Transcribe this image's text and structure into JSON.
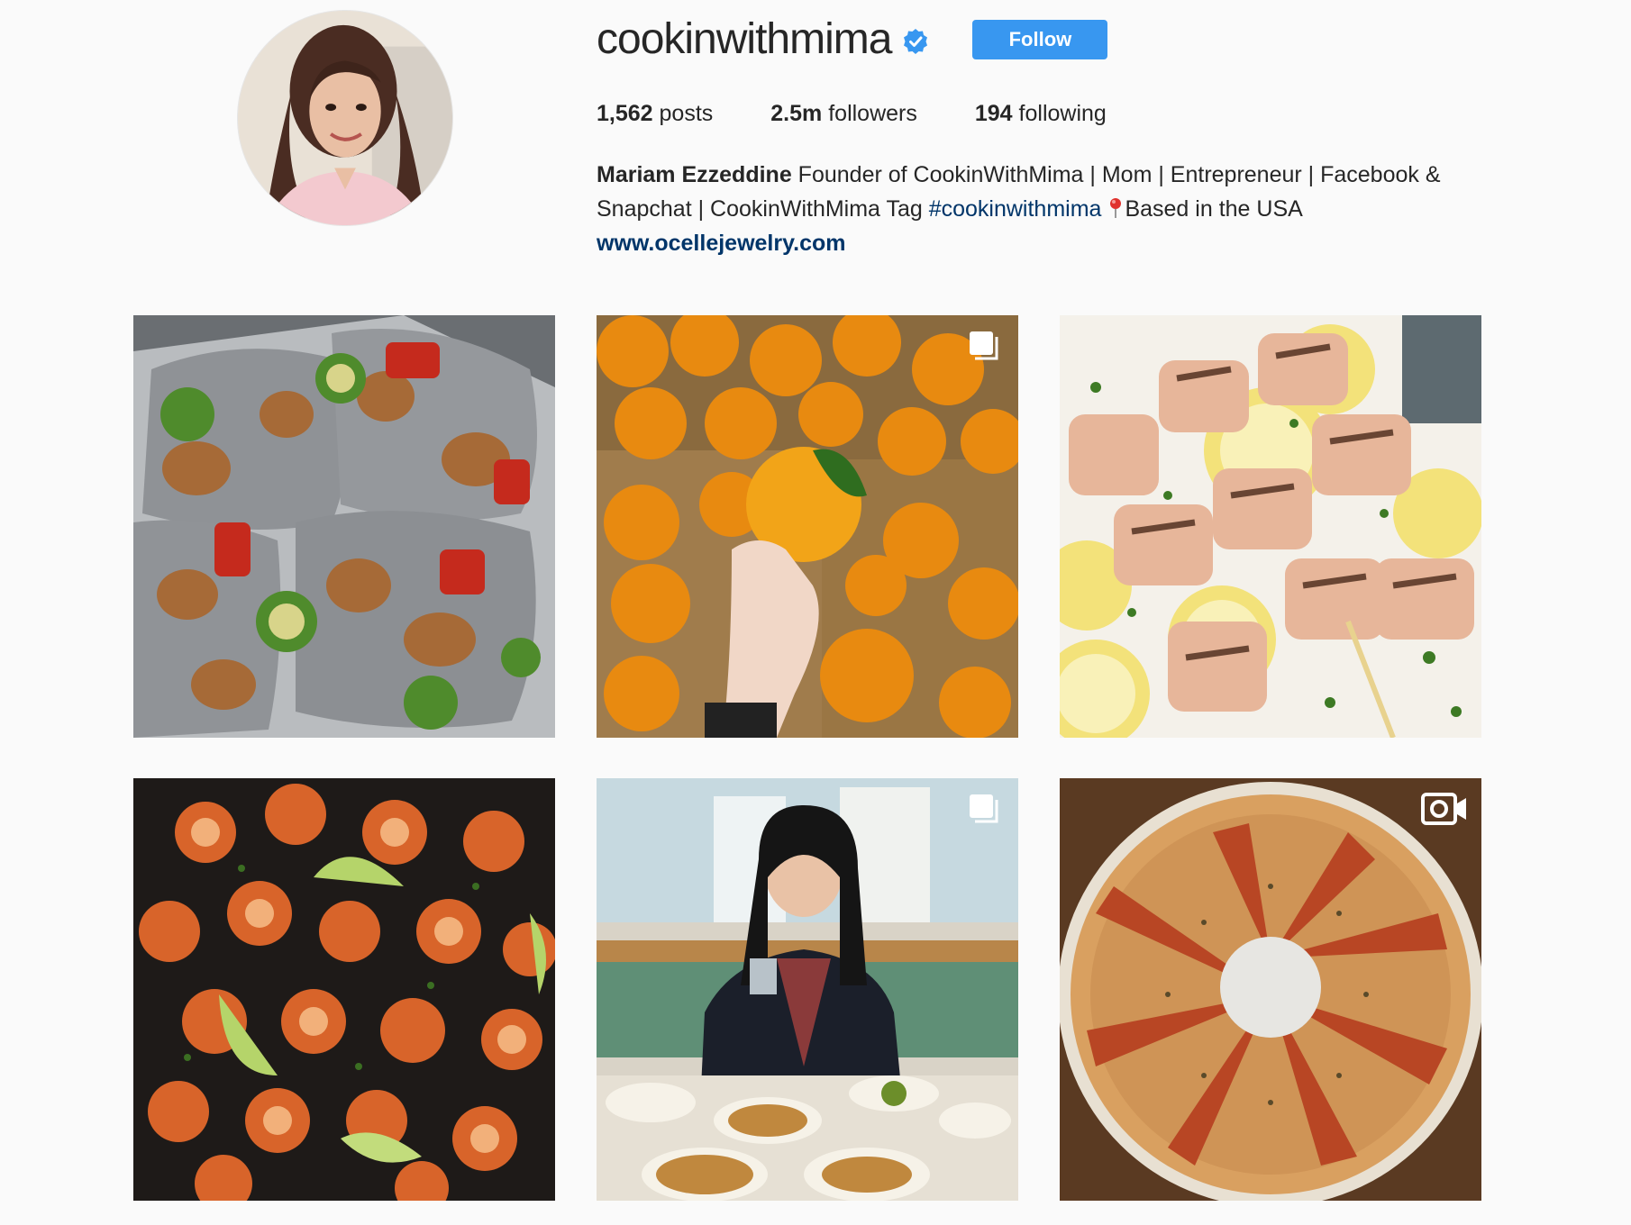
{
  "profile": {
    "username": "cookinwithmima",
    "verified": true,
    "follow_label": "Follow",
    "avatar_alt": "profile-photo"
  },
  "stats": {
    "posts_count": "1,562",
    "posts_label": "posts",
    "followers_count": "2.5m",
    "followers_label": "followers",
    "following_count": "194",
    "following_label": "following"
  },
  "bio": {
    "name": "Mariam Ezzeddine",
    "text_1": " Founder of CookinWithMima | Mom | Entrepreneur | Facebook & Snapchat | CookinWithMima Tag ",
    "hashtag": "#cookinwithmima",
    "text_2": "Based in the USA ",
    "website": "www.ocellejewelry.com"
  },
  "posts": [
    {
      "subject": "chicken-vegetable-foil-packets",
      "type": "image"
    },
    {
      "subject": "oranges-in-boxes",
      "type": "carousel"
    },
    {
      "subject": "grilled-salmon-skewers-lemon",
      "type": "image"
    },
    {
      "subject": "shrimp-skillet-lime",
      "type": "image"
    },
    {
      "subject": "woman-restaurant-table",
      "type": "carousel"
    },
    {
      "subject": "bread-ring-pastry",
      "type": "video"
    }
  ],
  "colors": {
    "accent_blue": "#3897f0",
    "link_blue": "#003569",
    "verified_blue": "#3897f0",
    "background": "#fafafa",
    "text": "#262626"
  }
}
